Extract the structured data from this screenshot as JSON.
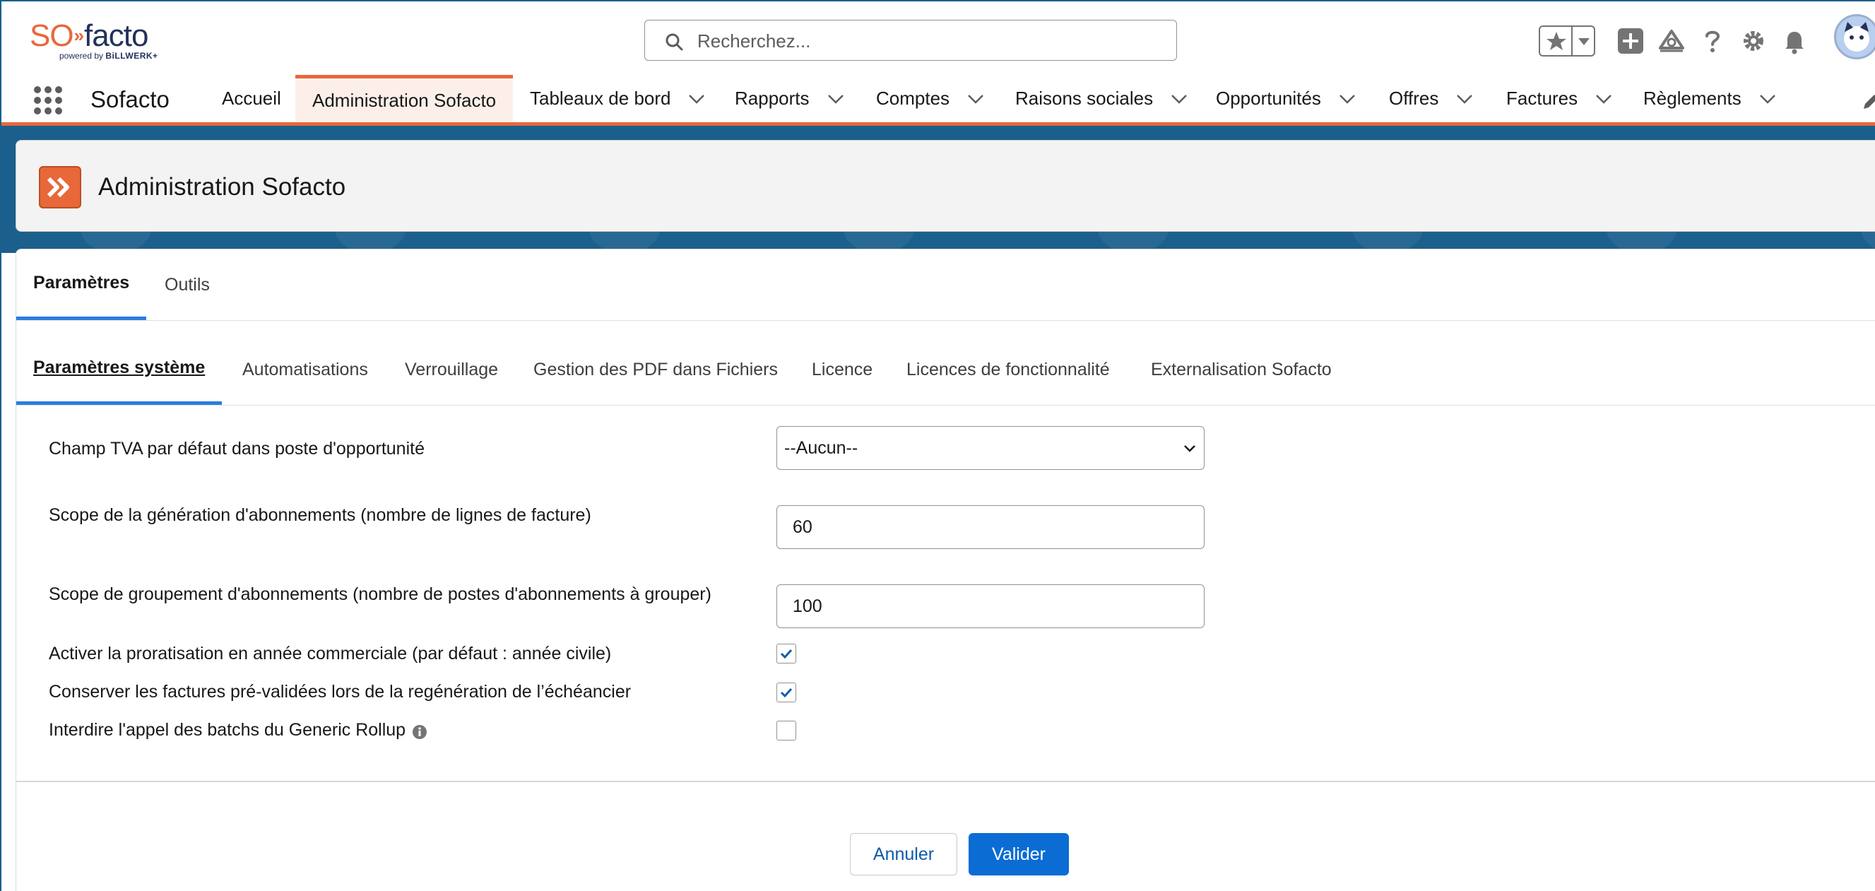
{
  "brand": {
    "logo_so": "SO",
    "logo_facto": "facto",
    "logo_powered": "powered by",
    "logo_billwerk": "BiLLWERK+"
  },
  "search": {
    "placeholder": "Recherchez..."
  },
  "nav": {
    "app_name": "Sofacto",
    "items": [
      {
        "label": "Accueil",
        "has_menu": false
      },
      {
        "label": "Administration Sofacto",
        "has_menu": false,
        "active": true
      },
      {
        "label": "Tableaux de bord",
        "has_menu": true
      },
      {
        "label": "Rapports",
        "has_menu": true
      },
      {
        "label": "Comptes",
        "has_menu": true
      },
      {
        "label": "Raisons sociales",
        "has_menu": true
      },
      {
        "label": "Opportunités",
        "has_menu": true
      },
      {
        "label": "Offres",
        "has_menu": true
      },
      {
        "label": "Factures",
        "has_menu": true
      },
      {
        "label": "Règlements",
        "has_menu": true
      }
    ]
  },
  "page": {
    "title": "Administration Sofacto"
  },
  "tabs": [
    {
      "label": "Paramètres",
      "active": true
    },
    {
      "label": "Outils",
      "active": false
    }
  ],
  "subtabs": [
    {
      "label": "Paramètres système",
      "active": true
    },
    {
      "label": "Automatisations"
    },
    {
      "label": "Verrouillage"
    },
    {
      "label": "Gestion des PDF dans Fichiers"
    },
    {
      "label": "Licence"
    },
    {
      "label": "Licences de fonctionnalité"
    },
    {
      "label": "Externalisation Sofacto"
    }
  ],
  "form": {
    "vat_field_label": "Champ TVA par défaut dans poste d'opportunité",
    "vat_field_value": "--Aucun--",
    "gen_scope_label": "Scope de la génération d'abonnements (nombre de lignes de facture)",
    "gen_scope_value": "60",
    "group_scope_label": "Scope de groupement d'abonnements (nombre de postes d'abonnements à grouper)",
    "group_scope_value": "100",
    "proration_label": "Activer la proratisation en année commerciale (par défaut : année civile)",
    "proration_checked": true,
    "keep_invoices_label": "Conserver les factures pré-validées lors de la regénération de l’échéancier",
    "keep_invoices_checked": true,
    "forbid_batches_label": "Interdire l'appel des batchs du Generic Rollup",
    "forbid_batches_checked": false
  },
  "buttons": {
    "cancel": "Annuler",
    "submit": "Valider"
  },
  "colors": {
    "accent": "#e8683a",
    "brand_blue": "#1b5f8c",
    "primary": "#0b6cd4",
    "tab_underline": "#2a7de1"
  }
}
